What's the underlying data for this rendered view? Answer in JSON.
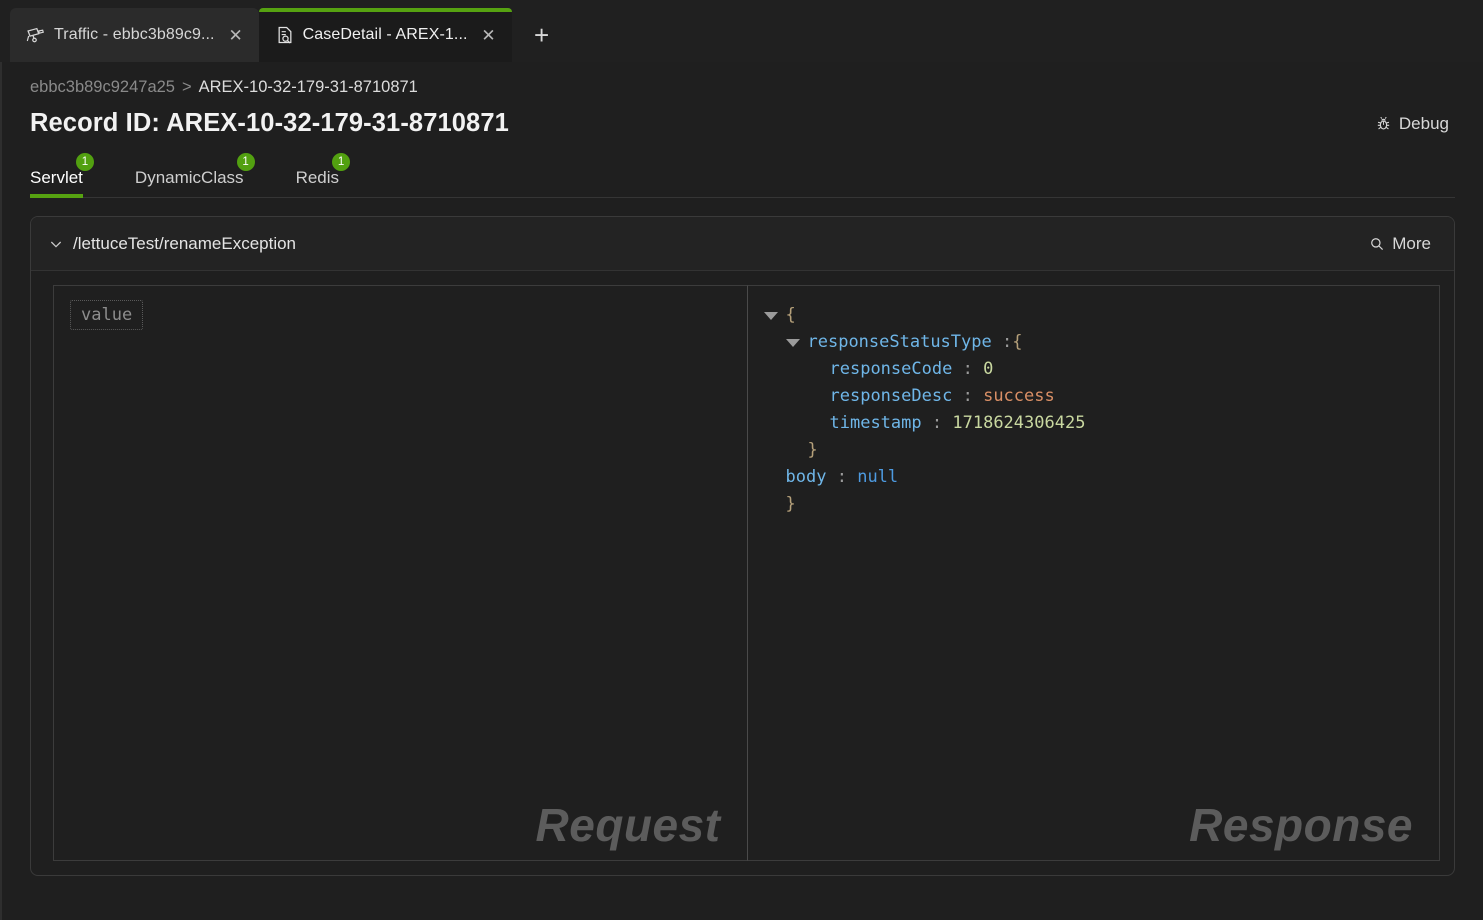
{
  "browser": {
    "tabs": [
      {
        "title": "Traffic - ebbc3b89c9...",
        "icon": "cctv-camera-icon",
        "active": false,
        "close_label": "✕"
      },
      {
        "title": "CaseDetail - AREX-1...",
        "icon": "document-search-icon",
        "active": true,
        "close_label": "✕"
      }
    ],
    "new_tab_label": "+",
    "active_accent": "#56a211"
  },
  "breadcrumb": {
    "parent": "ebbc3b89c9247a25",
    "separator": ">",
    "current": "AREX-10-32-179-31-8710871"
  },
  "header": {
    "record_title": "Record ID: AREX-10-32-179-31-8710871",
    "debug_label": "Debug",
    "debug_icon": "bug-icon"
  },
  "category_tabs": [
    {
      "label": "Servlet",
      "badge": "1",
      "active": true
    },
    {
      "label": "DynamicClass",
      "badge": "1",
      "active": false
    },
    {
      "label": "Redis",
      "badge": "1",
      "active": false
    }
  ],
  "card": {
    "chevron_icon": "chevron-down-icon",
    "title": "/lettuceTest/renameException",
    "more_label": "More",
    "more_icon": "search-icon"
  },
  "request_pane": {
    "watermark": "Request",
    "value_chip": "value"
  },
  "response_pane": {
    "watermark": "Response",
    "tree": {
      "open_brace": "{",
      "root_key": "responseStatusType",
      "root_colon": ":",
      "root_brace": "{",
      "fields": [
        {
          "key": "responseCode",
          "colon": ":",
          "value": "0",
          "type": "num"
        },
        {
          "key": "responseDesc",
          "colon": ":",
          "value": "success",
          "type": "str"
        },
        {
          "key": "timestamp",
          "colon": ":",
          "value": "1718624306425",
          "type": "num"
        }
      ],
      "inner_close": "}",
      "body_key": "body",
      "body_colon": ":",
      "body_value": "null",
      "outer_close": "}"
    }
  },
  "colors": {
    "accent_green": "#56a211",
    "badge_green": "#52a010",
    "json_key": "#6fb6e8",
    "json_string": "#d98f66",
    "json_number": "#c9d8a0",
    "json_null": "#4d9ae0",
    "page_bg": "#1f1f1f"
  }
}
